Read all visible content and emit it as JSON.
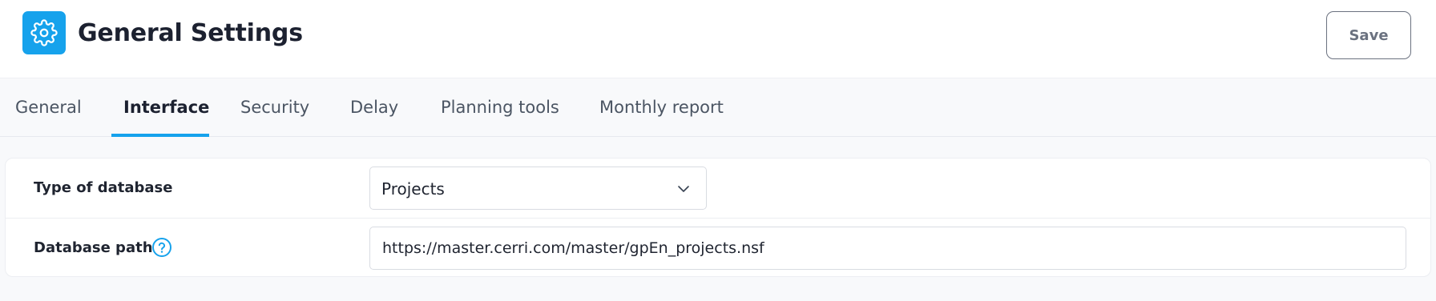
{
  "header": {
    "title": "General Settings",
    "icon": "gear-icon",
    "save_label": "Save"
  },
  "tabs": [
    {
      "label": "General",
      "active": false
    },
    {
      "label": "Interface",
      "active": true
    },
    {
      "label": "Security",
      "active": false
    },
    {
      "label": "Delay",
      "active": false
    },
    {
      "label": "Planning tools",
      "active": false
    },
    {
      "label": "Monthly report",
      "active": false
    }
  ],
  "form": {
    "database_type": {
      "label": "Type of database",
      "value": "Projects"
    },
    "database_path": {
      "label": "Database path",
      "value": "https://master.cerri.com/master/gpEn_projects.nsf",
      "help_icon": "help-circle-icon"
    }
  },
  "colors": {
    "accent": "#16a2ec",
    "background": "#f8f9fb",
    "text": "#1f2430"
  }
}
